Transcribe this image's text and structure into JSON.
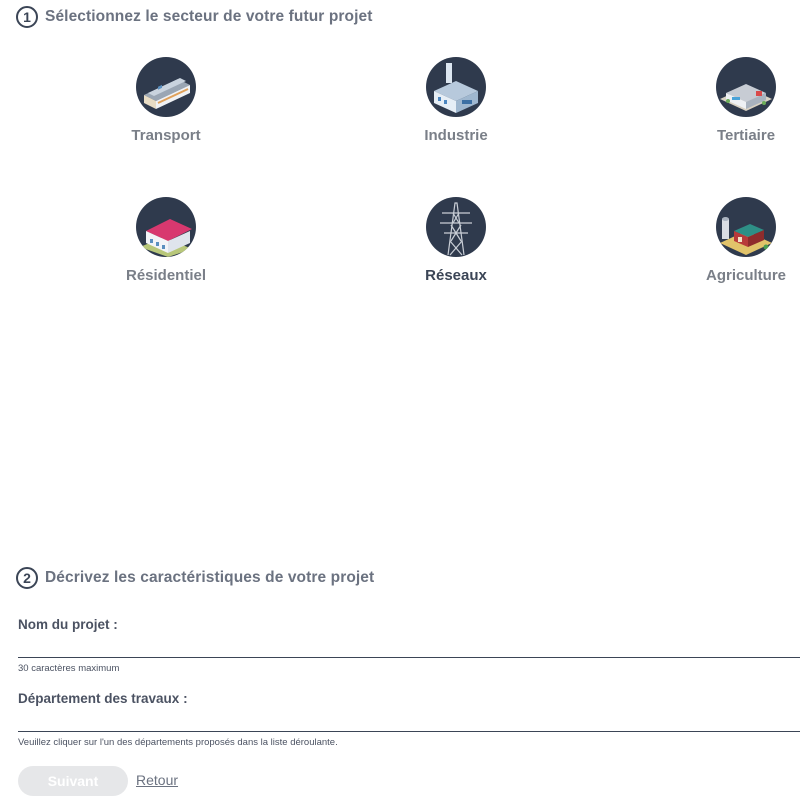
{
  "step1": {
    "number": "1",
    "title": "Sélectionnez le secteur de votre futur projet"
  },
  "sectors": [
    {
      "label": "Transport",
      "icon": "train-icon"
    },
    {
      "label": "Industrie",
      "icon": "factory-icon"
    },
    {
      "label": "Tertiaire",
      "icon": "office-building-icon"
    },
    {
      "label": "Résidentiel",
      "icon": "house-icon"
    },
    {
      "label": "Réseaux",
      "icon": "power-pylon-icon"
    },
    {
      "label": "Agriculture",
      "icon": "farm-icon"
    }
  ],
  "step2": {
    "number": "2",
    "title": "Décrivez les caractéristiques de votre projet"
  },
  "form": {
    "project_name_label": "Nom du projet :",
    "project_name_value": "",
    "project_name_hint": "30 caractères maximum",
    "department_label": "Département des travaux :",
    "department_value": "",
    "department_hint": "Veuillez cliquer sur l'un des départements proposés dans la liste déroulante."
  },
  "actions": {
    "next_label": "Suivant",
    "back_label": "Retour"
  },
  "colors": {
    "icon_bg": "#2f3a4d",
    "text_dark": "#3b4556",
    "text_muted": "#7a7f88",
    "button_disabled": "#e6e7e9"
  }
}
